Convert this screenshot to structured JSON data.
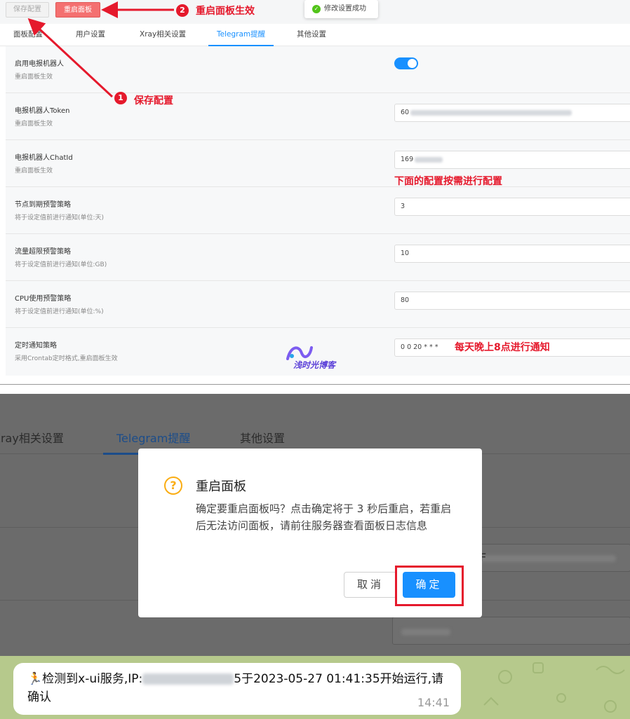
{
  "panel1": {
    "toolbar": {
      "save_label": "保存配置",
      "restart_label": "重启面板"
    },
    "toast": {
      "text": "修改设置成功"
    },
    "tabs": [
      {
        "label": "面板配置"
      },
      {
        "label": "用户设置"
      },
      {
        "label": "Xray相关设置"
      },
      {
        "label": "Telegram提醒"
      },
      {
        "label": "其他设置"
      }
    ],
    "active_tab": "Telegram提醒",
    "settings": [
      {
        "label": "启用电报机器人",
        "hint": "重启面板生效",
        "type": "switch",
        "value": "on"
      },
      {
        "label": "电报机器人Token",
        "hint": "重启面板生效",
        "type": "input",
        "value": "60"
      },
      {
        "label": "电报机器人ChatId",
        "hint": "重启面板生效",
        "type": "input",
        "value": "169"
      },
      {
        "label": "节点到期预警策略",
        "hint": "将于设定值前进行通知(单位:天)",
        "type": "input",
        "value": "3"
      },
      {
        "label": "流量超限预警策略",
        "hint": "将于设定值前进行通知(单位:GB)",
        "type": "input",
        "value": "10"
      },
      {
        "label": "CPU使用预警策略",
        "hint": "将于设定值前进行通知(单位:%)",
        "type": "input",
        "value": "80"
      },
      {
        "label": "定时通知策略",
        "hint": "采用Crontab定时格式,重启面板生效",
        "type": "input",
        "value": "0 0 20 * * *"
      }
    ],
    "annotations": {
      "step1_num": "1",
      "step1_text": "保存配置",
      "step2_num": "2",
      "step2_text": "重启面板生效",
      "config_note": "下面的配置按需进行配置",
      "cron_note": "每天晚上8点进行通知"
    },
    "watermark": "浅时光博客",
    "colors": {
      "accent": "#1890ff",
      "annotation": "#e5192c",
      "restart_button": "#f47070"
    }
  },
  "panel2": {
    "tabs": [
      {
        "label": "Xray相关设置"
      },
      {
        "label": "Telegram提醒"
      },
      {
        "label": "其他设置"
      }
    ],
    "dialog": {
      "icon": "question-circle-icon",
      "title": "重启面板",
      "message": "确定要重启面板吗？点击确定将于 3 秒后重启，若重启后无法访问面板，请前往服务器查看面板日志信息",
      "cancel_label": "取消",
      "ok_label": "确定"
    },
    "partial_input_text": "F"
  },
  "panel3": {
    "message_prefix": "检测到x-ui服务,IP:",
    "message_ip_tail": "5",
    "message_suffix": "于2023-05-27 01:41:35开始运行,请确认",
    "time": "14:41",
    "emoji": "🏃"
  }
}
